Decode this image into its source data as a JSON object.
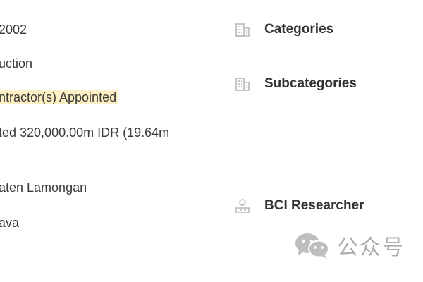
{
  "details": {
    "year": "2002",
    "sector": "uction",
    "stage": "ntractor(s) Appointed",
    "value": "ted 320,000.00m IDR (19.64m",
    "district": "aten Lamongan",
    "province": "ava"
  },
  "sidebar": {
    "categories_label": "Categories",
    "subcategories_label": "Subcategories",
    "researcher_label": "BCI Researcher"
  },
  "watermark": {
    "text": "公众号"
  },
  "colors": {
    "highlight": "#fdf0c4",
    "icon": "#b8b8b8",
    "text": "#333333"
  }
}
